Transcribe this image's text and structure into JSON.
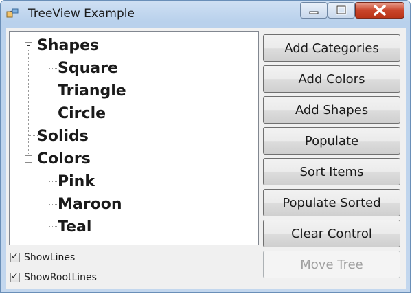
{
  "window": {
    "title": "TreeView Example"
  },
  "tree": {
    "nodes": [
      {
        "label": "Shapes",
        "children": [
          "Square",
          "Triangle",
          "Circle"
        ]
      },
      {
        "label": "Solids"
      },
      {
        "label": "Colors",
        "children": [
          "Pink",
          "Maroon",
          "Teal"
        ]
      }
    ]
  },
  "buttons": {
    "add_categories": "Add Categories",
    "add_colors": "Add Colors",
    "add_shapes": "Add Shapes",
    "populate": "Populate",
    "sort_items": "Sort Items",
    "populate_sorted": "Populate Sorted",
    "clear_control": "Clear Control",
    "move_tree": "Move Tree"
  },
  "options": {
    "show_lines": {
      "label": "ShowLines",
      "checked": true
    },
    "show_root_lines": {
      "label": "ShowRootLines",
      "checked": true
    }
  }
}
